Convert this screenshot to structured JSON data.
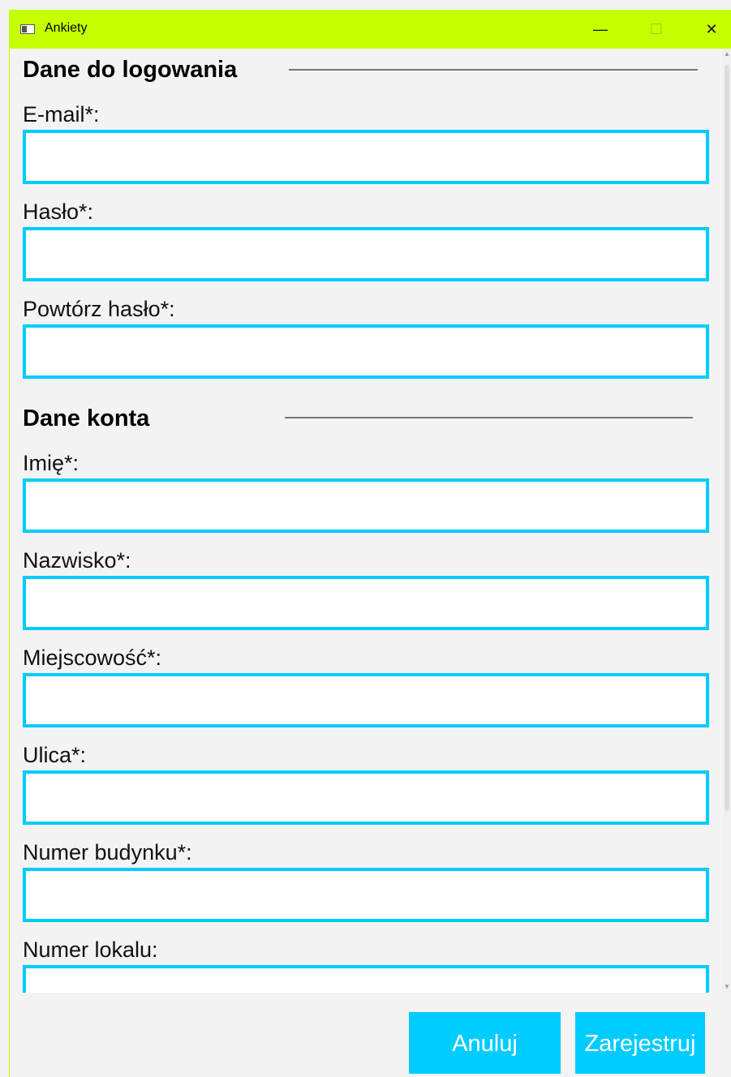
{
  "window": {
    "title": "Ankiety",
    "minimize_glyph": "—",
    "maximize_glyph": "☐",
    "close_glyph": "✕"
  },
  "sections": {
    "login_title": "Dane do logowania",
    "account_title": "Dane konta"
  },
  "fields": {
    "email": {
      "label": "E-mail*:",
      "value": ""
    },
    "password": {
      "label": "Hasło*:",
      "value": ""
    },
    "repeat_password": {
      "label": "Powtórz hasło*:",
      "value": ""
    },
    "first_name": {
      "label": "Imię*:",
      "value": ""
    },
    "last_name": {
      "label": "Nazwisko*:",
      "value": ""
    },
    "city": {
      "label": "Miejscowość*:",
      "value": ""
    },
    "street": {
      "label": "Ulica*:",
      "value": ""
    },
    "building_number": {
      "label": "Numer budynku*:",
      "value": ""
    },
    "apartment_number": {
      "label": "Numer lokalu:",
      "value": ""
    }
  },
  "buttons": {
    "cancel": "Anuluj",
    "register": "Zarejestruj"
  },
  "colors": {
    "titlebar": "#c6ff00",
    "accent": "#00ccff"
  },
  "icons": {
    "app": "app-window-icon",
    "minimize": "minimize-icon",
    "maximize": "maximize-icon",
    "close": "close-icon"
  }
}
